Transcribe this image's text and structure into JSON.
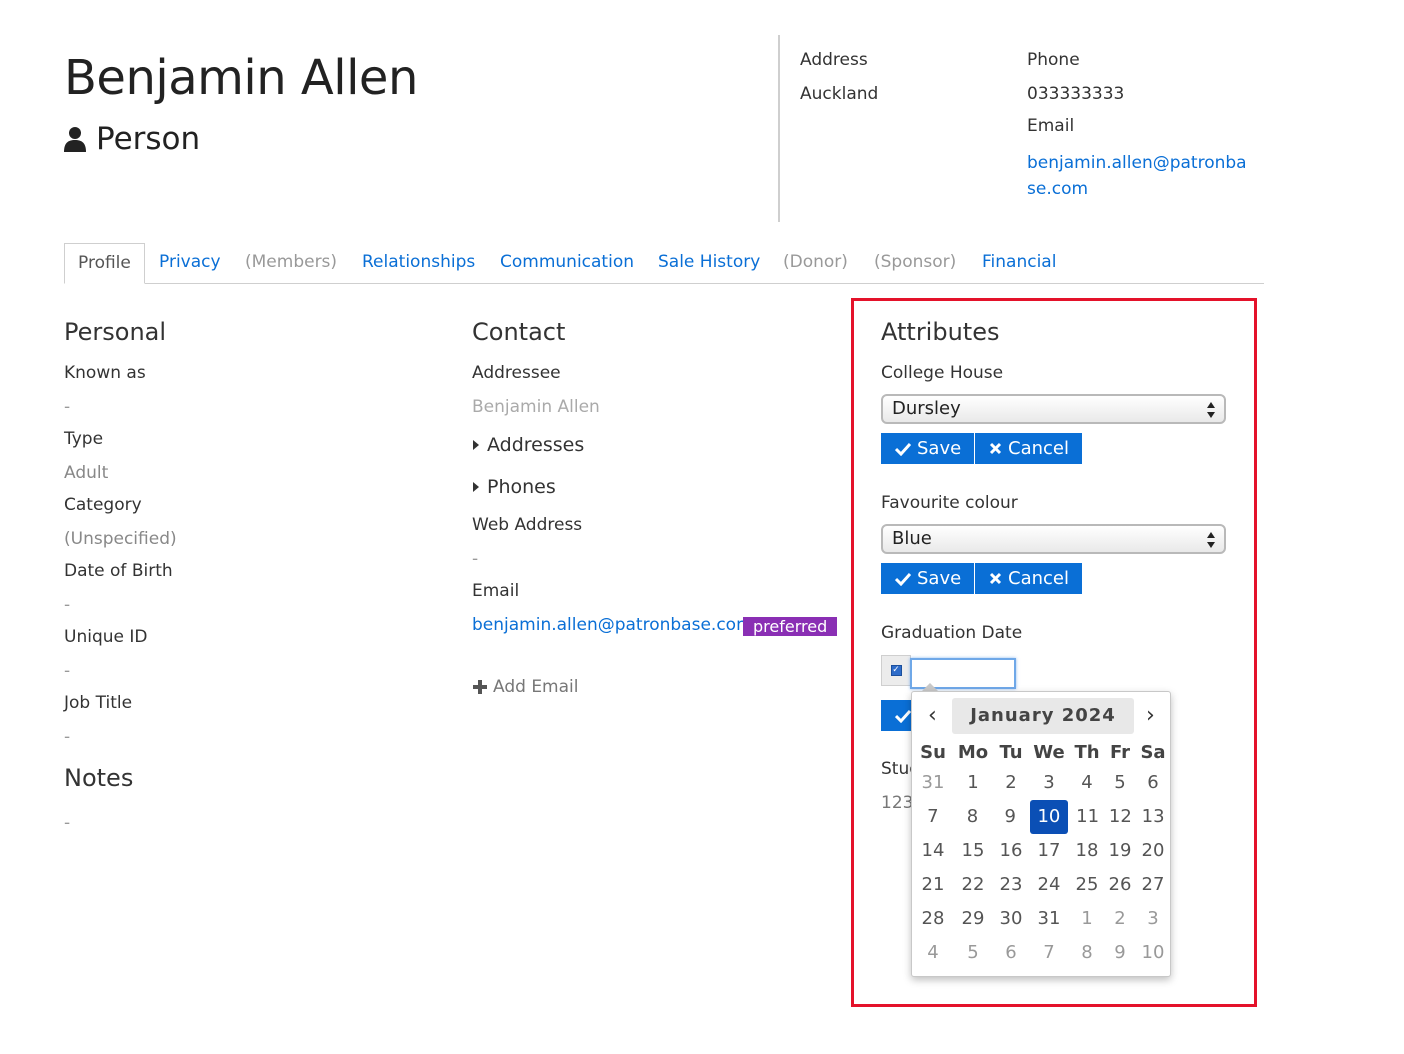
{
  "header": {
    "name": "Benjamin Allen",
    "type": "Person",
    "address_label": "Address",
    "address_value": "Auckland",
    "phone_label": "Phone",
    "phone_value": "033333333",
    "email_label": "Email",
    "email_line1": "benjamin.allen@patronba",
    "email_line2": "se.com"
  },
  "tabs": [
    {
      "label": "Profile",
      "state": "active"
    },
    {
      "label": "Privacy",
      "state": "link"
    },
    {
      "label": "(Members)",
      "state": "disabled"
    },
    {
      "label": "Relationships",
      "state": "link"
    },
    {
      "label": "Communication",
      "state": "link"
    },
    {
      "label": "Sale History",
      "state": "link"
    },
    {
      "label": "(Donor)",
      "state": "disabled"
    },
    {
      "label": "(Sponsor)",
      "state": "disabled"
    },
    {
      "label": "Financial",
      "state": "link"
    }
  ],
  "personal": {
    "heading": "Personal",
    "fields": [
      {
        "label": "Known as",
        "value": "-"
      },
      {
        "label": "Type",
        "value": "Adult"
      },
      {
        "label": "Category",
        "value": "(Unspecified)"
      },
      {
        "label": "Date of Birth",
        "value": "-"
      },
      {
        "label": "Unique ID",
        "value": "-"
      },
      {
        "label": "Job Title",
        "value": "-"
      }
    ]
  },
  "notes": {
    "heading": "Notes",
    "value": "-"
  },
  "contact": {
    "heading": "Contact",
    "addressee_label": "Addressee",
    "addressee_value": "Benjamin Allen",
    "addresses_label": "Addresses",
    "phones_label": "Phones",
    "web_label": "Web Address",
    "web_value": "-",
    "email_label": "Email",
    "email_value": "benjamin.allen@patronbase.com",
    "preferred_badge": "preferred",
    "add_email": "Add Email"
  },
  "attributes": {
    "heading": "Attributes",
    "college_label": "College House",
    "college_value": "Dursley",
    "colour_label": "Favourite colour",
    "colour_value": "Blue",
    "save": "Save",
    "cancel": "Cancel",
    "grad_label": "Graduation Date",
    "grad_value": "",
    "student_label_partial": "Stud",
    "student_value_partial": "123"
  },
  "calendar": {
    "title": "January 2024",
    "prev": "‹",
    "next": "›",
    "weekdays": [
      "Su",
      "Mo",
      "Tu",
      "We",
      "Th",
      "Fr",
      "Sa"
    ],
    "weeks": [
      [
        "31",
        "1",
        "2",
        "3",
        "4",
        "5",
        "6"
      ],
      [
        "7",
        "8",
        "9",
        "10",
        "11",
        "12",
        "13"
      ],
      [
        "14",
        "15",
        "16",
        "17",
        "18",
        "19",
        "20"
      ],
      [
        "21",
        "22",
        "23",
        "24",
        "25",
        "26",
        "27"
      ],
      [
        "28",
        "29",
        "30",
        "31",
        "1",
        "2",
        "3"
      ],
      [
        "4",
        "5",
        "6",
        "7",
        "8",
        "9",
        "10"
      ]
    ],
    "selected": "10"
  },
  "colors": {
    "link": "#0a6fd6",
    "button": "#0a6fd6",
    "badge": "#8a2fb4",
    "highlight": "#e4122a",
    "selected_day": "#0b4fb5"
  }
}
